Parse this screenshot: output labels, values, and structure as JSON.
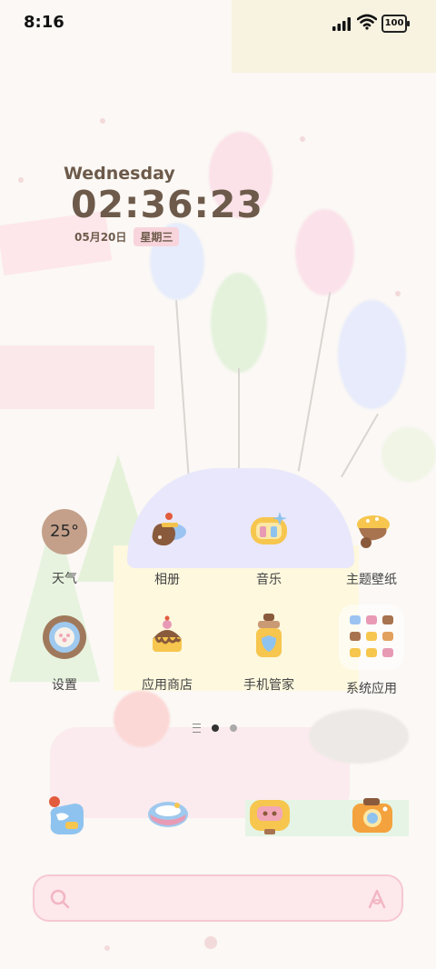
{
  "status_bar": {
    "time": "8:16",
    "battery": "100",
    "icons": [
      "signal-icon",
      "wifi-icon",
      "battery-icon"
    ]
  },
  "clock_widget": {
    "weekday": "Wednesday",
    "time": "02:36:23",
    "date": "05月20日",
    "weekday_cn": "星期三"
  },
  "apps": [
    {
      "label": "天气",
      "icon": "weather-icon",
      "temp": "25°"
    },
    {
      "label": "相册",
      "icon": "gallery-icon"
    },
    {
      "label": "音乐",
      "icon": "music-icon"
    },
    {
      "label": "主题壁纸",
      "icon": "themes-icon"
    },
    {
      "label": "设置",
      "icon": "settings-icon"
    },
    {
      "label": "应用商店",
      "icon": "app-store-icon"
    },
    {
      "label": "手机管家",
      "icon": "phone-manager-icon"
    },
    {
      "label": "系统应用",
      "icon": "system-apps-folder-icon"
    }
  ],
  "page_indicator": {
    "pages": 2,
    "current": 1
  },
  "dock": [
    "phone-icon",
    "messages-icon",
    "browser-icon",
    "camera-icon"
  ],
  "search_bar": {
    "icons": [
      "search-icon",
      "assistant-icon"
    ]
  },
  "colors": {
    "clock_text": "#6d5a4a",
    "weekday_badge": "#f8d5dc",
    "search_bg": "#fde8ec",
    "weather_circle": "#c4a08a"
  }
}
